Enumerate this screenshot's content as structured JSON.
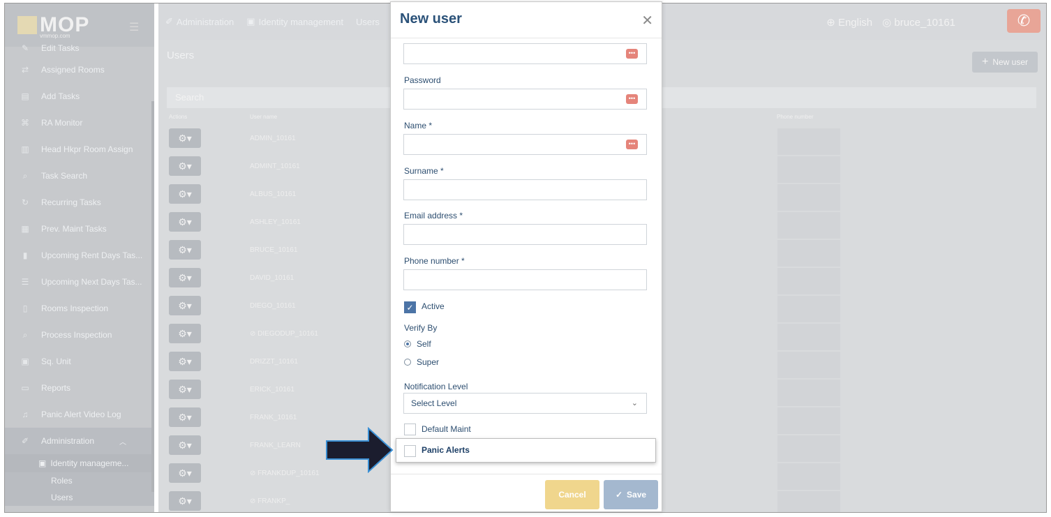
{
  "brand": {
    "logo": "MOP",
    "sub": "vmmop.com"
  },
  "sidebar": {
    "items": [
      {
        "label": "Edit Tasks",
        "icon": "edit-icon"
      },
      {
        "label": "Assigned Rooms",
        "icon": "swap-icon"
      },
      {
        "label": "Add Tasks",
        "icon": "list-icon"
      },
      {
        "label": "RA Monitor",
        "icon": "binoculars-icon"
      },
      {
        "label": "Head Hkpr Room Assign",
        "icon": "building-icon"
      },
      {
        "label": "Task Search",
        "icon": "search-icon"
      },
      {
        "label": "Recurring Tasks",
        "icon": "repeat-icon"
      },
      {
        "label": "Prev. Maint Tasks",
        "icon": "calendar-icon"
      },
      {
        "label": "Upcoming Rent Days Tas...",
        "icon": "clipboard-icon"
      },
      {
        "label": "Upcoming Next Days Tas...",
        "icon": "list-icon"
      },
      {
        "label": "Rooms Inspection",
        "icon": "door-icon"
      },
      {
        "label": "Process Inspection",
        "icon": "search-icon"
      },
      {
        "label": "Sq. Unit",
        "icon": "grid-icon"
      },
      {
        "label": "Reports",
        "icon": "report-icon"
      },
      {
        "label": "Panic Alert Video Log",
        "icon": "bell-icon"
      },
      {
        "label": "Administration",
        "icon": "wrench-icon"
      }
    ],
    "sub": "Identity manageme...",
    "sub_items": [
      "Roles",
      "Users"
    ]
  },
  "header": {
    "breadcrumbs": [
      "Administration",
      "Identity management",
      "Users"
    ],
    "language": "English",
    "user": "bruce_10161"
  },
  "main": {
    "title": "Users",
    "new_user": "New user",
    "search_placeholder": "Search",
    "columns": {
      "actions": "Actions",
      "username": "User name",
      "phone": "Phone number"
    },
    "users": [
      "ADMIN_10161",
      "ADMINT_10161",
      "ALBUS_10161",
      "ASHLEY_10161",
      "BRUCE_10161",
      "DAVID_10161",
      "DIEGO_10161",
      "DIEGODUP_10161",
      "DRIZZT_10161",
      "ERICK_10161",
      "FRANK_10161",
      "FRANK_LEARN",
      "FRANKDUP_10161",
      "FRANKP_"
    ]
  },
  "modal": {
    "title": "New user",
    "password_label": "Password",
    "name_label": "Name *",
    "surname_label": "Surname *",
    "email_label": "Email address *",
    "phone_label": "Phone number *",
    "active_label": "Active",
    "verify_label": "Verify By",
    "verify_self": "Self",
    "verify_super": "Super",
    "notification_label": "Notification Level",
    "notification_value": "Select Level",
    "default_maint": "Default Maint",
    "panic_alerts": "Panic Alerts",
    "cancel": "Cancel",
    "save": "Save",
    "active_checked": true,
    "verify_selected": "Self"
  }
}
